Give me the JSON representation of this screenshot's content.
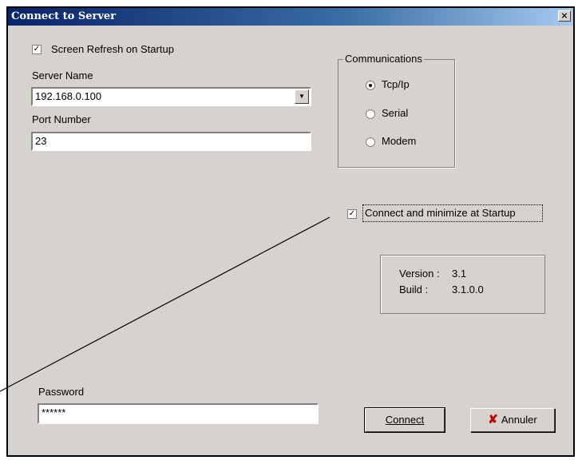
{
  "window": {
    "title": "Connect to Server",
    "close_glyph": "×"
  },
  "options": {
    "screen_refresh_label": "Screen Refresh on Startup",
    "screen_refresh_checked": true,
    "connect_minimize_label": "Connect and minimize at Startup",
    "connect_minimize_checked": true
  },
  "server": {
    "label": "Server Name",
    "value": "192.168.0.100",
    "dropdown_glyph": "▼"
  },
  "port": {
    "label": "Port Number",
    "value": "23"
  },
  "communications": {
    "label": "Communications",
    "options": [
      {
        "label": "Tcp/Ip",
        "selected": true
      },
      {
        "label": "Serial",
        "selected": false
      },
      {
        "label": "Modem",
        "selected": false
      }
    ]
  },
  "info": {
    "version_label": "Version :",
    "version_value": "3.1",
    "build_label": "Build :",
    "build_value": "3.1.0.0"
  },
  "password": {
    "label": "Password",
    "value": "******"
  },
  "buttons": {
    "connect_label": "Connect",
    "cancel_label": "Annuler",
    "cancel_icon_glyph": "✘"
  },
  "check_glyph": "✓"
}
